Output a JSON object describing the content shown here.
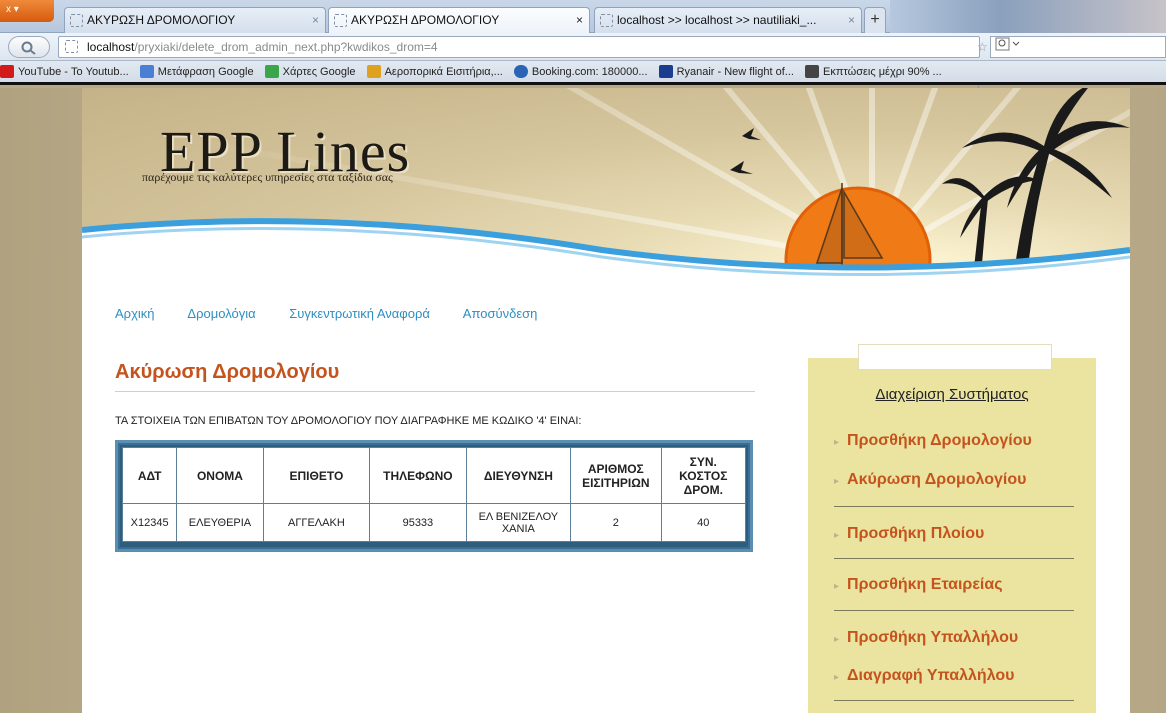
{
  "browser": {
    "menu_button": "x",
    "tabs": [
      {
        "title": "ΑΚΥΡΩΣΗ ΔΡΟΜΟΛΟΓΙΟΥ",
        "close": "×"
      },
      {
        "title": "ΑΚΥΡΩΣΗ ΔΡΟΜΟΛΟΓΙΟΥ",
        "close": "×"
      },
      {
        "title": "localhost >> localhost >> nautiliaki_...",
        "close": "×"
      }
    ],
    "new_tab": "+",
    "url_host": "localhost",
    "url_path": "/pryxiaki/delete_drom_admin_next.php?kwdikos_drom=4",
    "url_icons": "☆ ▽ C",
    "bookmarks": [
      {
        "label": "YouTube - Το Youtub...",
        "color": "#d21a1a"
      },
      {
        "label": "Μετάφραση Google",
        "color": "#4a7fd6"
      },
      {
        "label": "Χάρτες Google",
        "color": "#3aa54a"
      },
      {
        "label": "Αεροπορικά Εισιτήρια,...",
        "color": "#e0a020"
      },
      {
        "label": "Booking.com: 180000...",
        "color": "#2b63b5"
      },
      {
        "label": "Ryanair - New flight of...",
        "color": "#1a3d8f"
      },
      {
        "label": "Εκπτώσεις μέχρι 90% ...",
        "color": "#444444"
      }
    ]
  },
  "site": {
    "logo_title": "EPP Lines",
    "logo_subtitle": "παρέχουμε τις καλύτερες υπηρεσίες στα ταξίδια σας",
    "menu": [
      "Αρχική",
      "Δρομολόγια",
      "Συγκεντρωτική Αναφορά",
      "Αποσύνδεση"
    ]
  },
  "main": {
    "title": "Ακύρωση Δρομολογίου",
    "intro": "ΤΑ ΣΤΟΙΧΕΙΑ ΤΩΝ ΕΠΙΒΑΤΩΝ ΤΟΥ ΔΡΟΜΟΛΟΓΙΟΥ ΠΟΥ ΔΙΑΓΡΑΦΗΚΕ ΜΕ ΚΩΔΙΚΟ '4' ΕΙΝΑΙ:",
    "table": {
      "headers": [
        "ΑΔΤ",
        "ΟΝΟΜΑ",
        "ΕΠΙΘΕΤΟ",
        "ΤΗΛΕΦΩΝΟ",
        "ΔΙΕΥΘΥΝΣΗ",
        "ΑΡΙΘΜΟΣ ΕΙΣΙΤΗΡΙΩΝ",
        "ΣΥΝ. ΚΟΣΤΟΣ ΔΡΟΜ."
      ],
      "rows": [
        [
          "Χ12345",
          "ΕΛΕΥΘΕΡΙΑ",
          "ΑΓΓΕΛΑΚΗ",
          "95333",
          "ΕΛ ΒΕΝΙΖΕΛΟΥ ΧΑΝΙΑ",
          "2",
          "40"
        ]
      ]
    }
  },
  "sidebar": {
    "title": "Διαχείριση Συστήματος",
    "items": [
      "Προσθήκη Δρομολογίου",
      "Ακύρωση Δρομολογίου",
      "Προσθήκη Πλοίου",
      "Προσθήκη Εταιρείας",
      "Προσθήκη Υπαλλήλου",
      "Διαγραφή Υπαλλήλου"
    ]
  },
  "colors": {
    "accent": "#c4541e",
    "link": "#2d8fc2",
    "sidebar_bg": "#ebe3a0",
    "sun": "#f07a16"
  }
}
